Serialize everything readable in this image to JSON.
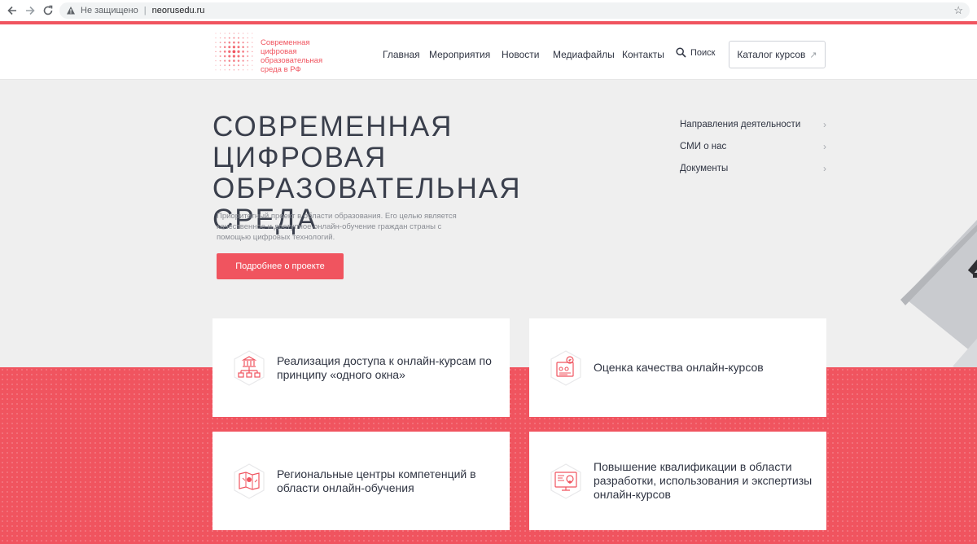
{
  "browser": {
    "security_label": "Не защищено",
    "url": "neorusedu.ru"
  },
  "header": {
    "logo_lines": [
      "Современная",
      "цифровая",
      "образовательная",
      "среда в РФ"
    ],
    "nav": [
      {
        "label": "Главная"
      },
      {
        "label": "Мероприятия"
      },
      {
        "label": "Новости"
      },
      {
        "label": "Медиафайлы"
      },
      {
        "label": "Контакты"
      }
    ],
    "search_label": "Поиск",
    "catalog_label": "Каталог курсов",
    "colors": {
      "accent": "#f0545f"
    }
  },
  "hero": {
    "title_lines": [
      "СОВРЕМЕННАЯ",
      "ЦИФРОВАЯ",
      "ОБРАЗОВАТЕЛЬНАЯ СРЕДА"
    ],
    "description": "Приоритетный проект в области образования. Его целью является качественное и доступное онлайн-обучение граждан страны с помощью цифровых технологий.",
    "button_label": "Подробнее о проекте"
  },
  "side_links": [
    {
      "label": "Направления деятельности"
    },
    {
      "label": "СМИ о нас"
    },
    {
      "label": "Документы"
    }
  ],
  "cards": [
    {
      "icon": "institution-network-icon",
      "text": "Реализация доступа к онлайн-курсам по принципу «одного окна»"
    },
    {
      "icon": "quality-assessment-icon",
      "text": "Оценка качества онлайн-курсов"
    },
    {
      "icon": "regional-map-icon",
      "text": "Региональные центры компетенций в области онлайн-обучения"
    },
    {
      "icon": "training-screen-icon",
      "text": "Повышение квалификации в области разработки, использования и экспертизы онлайн-курсов"
    }
  ]
}
